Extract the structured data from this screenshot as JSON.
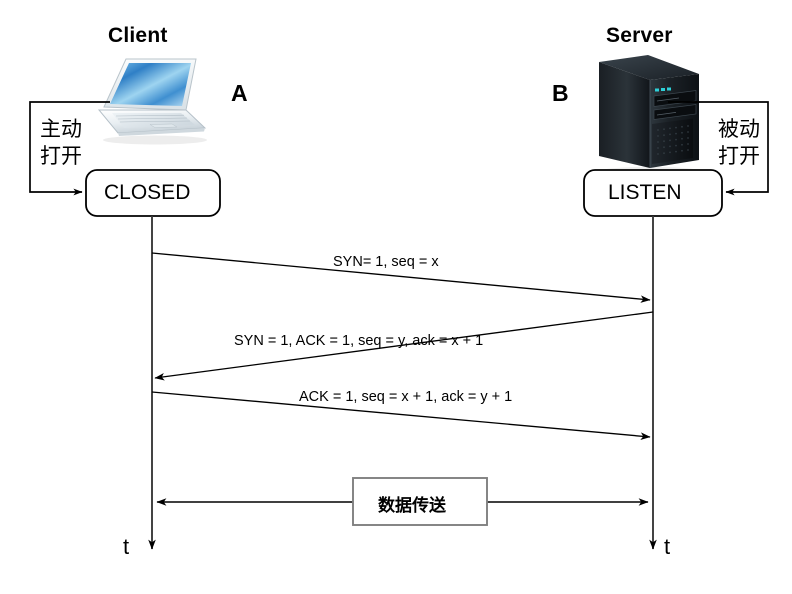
{
  "diagram": {
    "title_client": "Client",
    "title_server": "Server",
    "node_a": "A",
    "node_b": "B",
    "client_icon": "laptop-icon",
    "server_icon": "server-tower-icon",
    "client_state": "CLOSED",
    "server_state": "LISTEN",
    "client_open_label_line1": "主动",
    "client_open_label_line2": "打开",
    "server_open_label_line1": "被动",
    "server_open_label_line2": "打开",
    "messages": [
      {
        "label": "SYN= 1,   seq = x",
        "direction": "client-to-server"
      },
      {
        "label": "SYN = 1,  ACK = 1,   seq = y,  ack = x + 1",
        "direction": "server-to-client"
      },
      {
        "label": "ACK =  1,  seq = x + 1,   ack = y + 1",
        "direction": "client-to-server"
      }
    ],
    "data_transfer_label": "数据传送",
    "time_axis_left": "t",
    "time_axis_right": "t",
    "colors": {
      "line": "#000000",
      "timeline": "#404040",
      "data_box_border": "#808080",
      "background": "#ffffff"
    }
  }
}
